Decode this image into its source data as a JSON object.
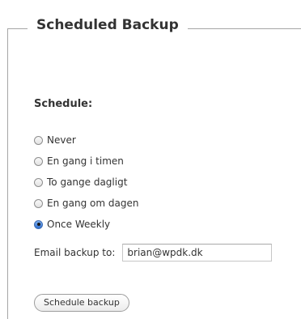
{
  "section": {
    "title": "Scheduled Backup"
  },
  "schedule": {
    "label": "Schedule:",
    "selected_index": 4,
    "options": [
      {
        "label": "Never",
        "checked": false
      },
      {
        "label": "En gang i timen",
        "checked": false
      },
      {
        "label": "To gange dagligt",
        "checked": false
      },
      {
        "label": "En gang om dagen",
        "checked": false
      },
      {
        "label": "Once Weekly",
        "checked": true
      }
    ]
  },
  "email": {
    "label": "Email backup to:",
    "value": "brian@wpdk.dk"
  },
  "actions": {
    "schedule_label": "Schedule backup"
  },
  "colors": {
    "frame_line": "#a6a6a6",
    "text": "#333333",
    "radio_selected": "#2f6fd0"
  }
}
